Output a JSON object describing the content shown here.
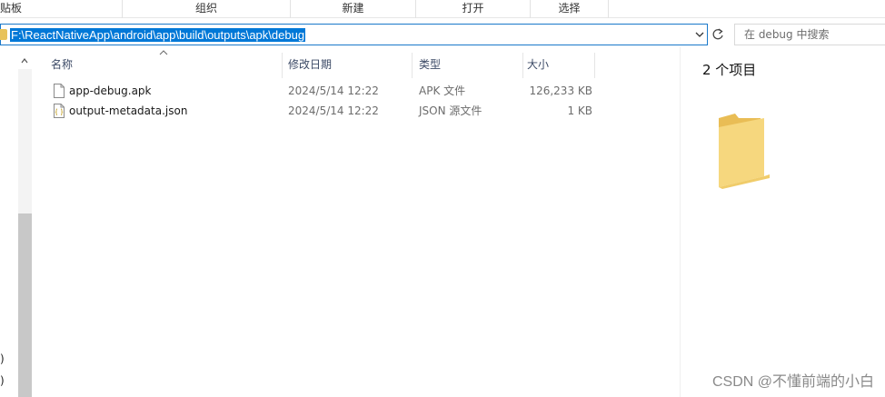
{
  "ribbon": {
    "groups": [
      "贴板",
      "组织",
      "新建",
      "打开",
      "选择"
    ]
  },
  "address_bar": {
    "path": "F:\\ReactNativeApp\\android\\app\\build\\outputs\\apk\\debug"
  },
  "search": {
    "placeholder": "在 debug 中搜索"
  },
  "nav_pane": {
    "fragments": [
      ")",
      ")"
    ]
  },
  "columns": {
    "name": "名称",
    "modified": "修改日期",
    "type": "类型",
    "size": "大小"
  },
  "files": [
    {
      "name": "app-debug.apk",
      "modified": "2024/5/14 12:22",
      "type": "APK 文件",
      "size": "126,233 KB",
      "icon": "blank-file-icon"
    },
    {
      "name": "output-metadata.json",
      "modified": "2024/5/14 12:22",
      "type": "JSON 源文件",
      "size": "1 KB",
      "icon": "json-file-icon"
    }
  ],
  "details_pane": {
    "item_count": "2 个项目",
    "icon": "folder-icon"
  },
  "watermark": "CSDN @不懂前端的小白",
  "colors": {
    "selection": "#0078d7",
    "address_border": "#1979ca",
    "folder": "#f0cf70",
    "column_header_text": "#3c4a66"
  }
}
